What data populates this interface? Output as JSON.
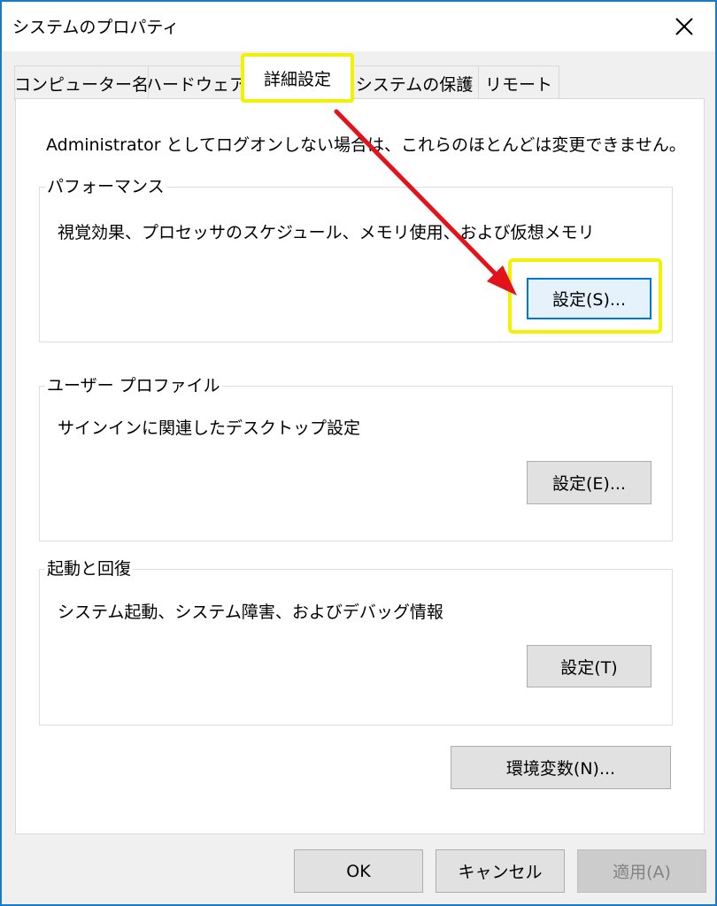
{
  "window": {
    "title": "システムのプロパティ"
  },
  "tabs": [
    {
      "label": "コンピューター名"
    },
    {
      "label": "ハードウェア"
    },
    {
      "label": "詳細設定"
    },
    {
      "label": "システムの保護"
    },
    {
      "label": "リモート"
    }
  ],
  "active_tab": "詳細設定",
  "advanced": {
    "admin_note": "Administrator としてログオンしない場合は、これらのほとんどは変更できません。",
    "performance": {
      "heading": "パフォーマンス",
      "description": "視覚効果、プロセッサのスケジュール、メモリ使用、および仮想メモリ",
      "settings_label": "設定(S)..."
    },
    "user_profiles": {
      "heading": "ユーザー プロファイル",
      "description": "サインインに関連したデスクトップ設定",
      "settings_label": "設定(E)..."
    },
    "startup_recovery": {
      "heading": "起動と回復",
      "description": "システム起動、システム障害、およびデバッグ情報",
      "settings_label": "設定(T)"
    },
    "env_vars_label": "環境変数(N)..."
  },
  "footer": {
    "ok_label": "OK",
    "cancel_label": "キャンセル",
    "apply_label": "適用(A)"
  },
  "colors": {
    "window_border": "#1979ca",
    "highlight": "#f2f200",
    "annotation_arrow": "#e3121b",
    "default_button_border": "#0078d7"
  }
}
